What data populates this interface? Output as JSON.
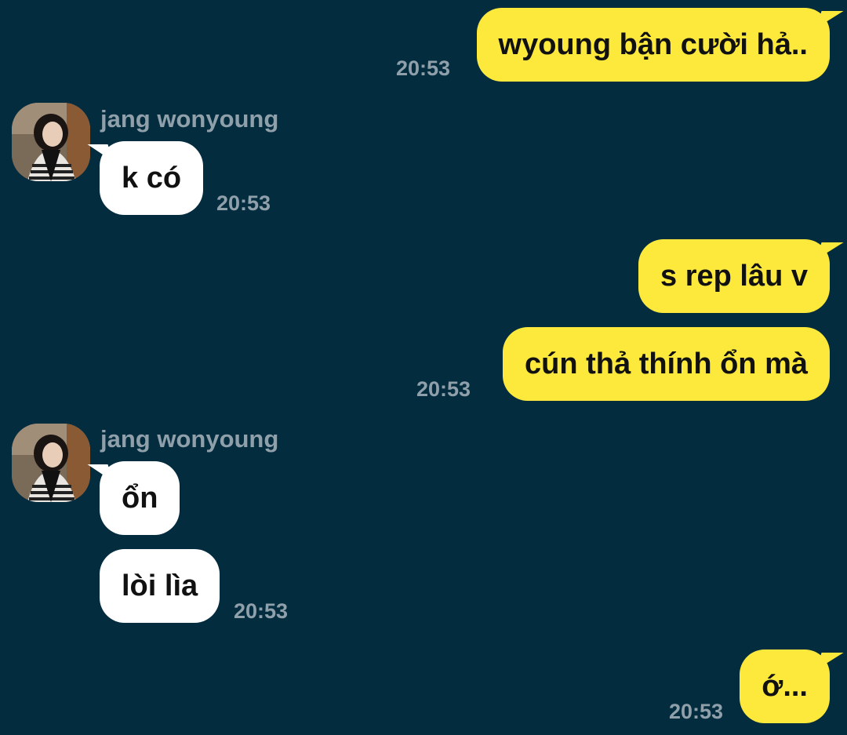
{
  "contact": {
    "name": "jang wonyoung"
  },
  "messages": [
    {
      "from": "me",
      "text": "wyoung bận cười hả..",
      "time": "20:53"
    },
    {
      "from": "them",
      "text": "k có",
      "time": "20:53"
    },
    {
      "from": "me",
      "text": "s rep lâu v",
      "time": ""
    },
    {
      "from": "me",
      "text": "cún thả thính ổn mà",
      "time": "20:53"
    },
    {
      "from": "them",
      "text": "ổn",
      "time": ""
    },
    {
      "from": "them",
      "text": "lòi lìa",
      "time": "20:53"
    },
    {
      "from": "me",
      "text": "ớ...",
      "time": "20:53"
    }
  ],
  "colors": {
    "background": "#032c3f",
    "my_bubble": "#fde93b",
    "their_bubble": "#ffffff",
    "meta_text": "#8fa0ab"
  },
  "icons": {
    "avatar": "profile-photo"
  }
}
